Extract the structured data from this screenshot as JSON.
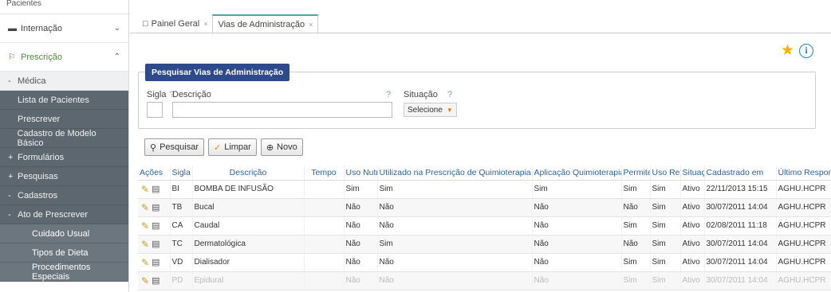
{
  "sidebar": {
    "top_label": "Pacientes",
    "items": [
      {
        "label": "Internação",
        "icon": "bed-icon",
        "chevron": "⌄"
      },
      {
        "label": "Prescrição",
        "icon": "pill-icon",
        "chevron": "⌃"
      }
    ],
    "medica": "Médica",
    "medica_prefix": "-",
    "sub": [
      {
        "prefix": "",
        "label": "Lista de Pacientes"
      },
      {
        "prefix": "",
        "label": "Prescrever"
      },
      {
        "prefix": "",
        "label": "Cadastro de Modelo Básico"
      },
      {
        "prefix": "+",
        "label": "Formulários"
      },
      {
        "prefix": "+",
        "label": "Pesquisas"
      },
      {
        "prefix": "-",
        "label": "Cadastros"
      },
      {
        "prefix": "-",
        "label": "Ato de Prescrever"
      }
    ],
    "sub2": [
      "Cuidado Usual",
      "Tipos de Dieta",
      "Procedimentos Especiais"
    ]
  },
  "tabs": [
    {
      "label": "Painel Geral",
      "close": "×"
    },
    {
      "label": "Vias de Administração",
      "close": "×"
    }
  ],
  "filter": {
    "legend": "Pesquisar Vias de Administração",
    "sigla_label": "Sigla",
    "descricao_label": "Descrição",
    "situacao_label": "Situação",
    "help": "?",
    "situacao_value": "Selecione"
  },
  "buttons": {
    "pesquisar": "Pesquisar",
    "limpar": "Limpar",
    "novo": "Novo"
  },
  "table": {
    "headers": [
      "Ações",
      "Sigla",
      "Descrição",
      "Tempo",
      "Uso Nutriç",
      "Utilizado na Prescrição de Quimioterapia",
      "Aplicação Quimioterapia CCA",
      "Permite E",
      "Uso Rece",
      "Situaçã",
      "Cadastrado em",
      "Último Responsável"
    ],
    "rows": [
      [
        "BI",
        "BOMBA DE INFUSÃO",
        "",
        "Sim",
        "Sim",
        "Sim",
        "Sim",
        "Sim",
        "Ativo",
        "22/11/2013 15:15",
        "AGHU.HCPR"
      ],
      [
        "TB",
        "Bucal",
        "",
        "Não",
        "Não",
        "Não",
        "Não",
        "Sim",
        "Ativo",
        "30/07/2011 14:04",
        "AGHU.HCPR"
      ],
      [
        "CA",
        "Caudal",
        "",
        "Não",
        "Não",
        "Não",
        "Sim",
        "Sim",
        "Ativo",
        "02/08/2011 11:18",
        "AGHU.HCPR"
      ],
      [
        "TC",
        "Dermatológica",
        "",
        "Não",
        "Sim",
        "Não",
        "Não",
        "Sim",
        "Ativo",
        "30/07/2011 14:04",
        "AGHU.HCPR"
      ],
      [
        "VD",
        "Dialisador",
        "",
        "Não",
        "Não",
        "Não",
        "Sim",
        "Sim",
        "Ativo",
        "30/07/2011 14:04",
        "AGHU.HCPR"
      ],
      [
        "PD",
        "Epidural",
        "",
        "Não",
        "Não",
        "Não",
        "Sim",
        "Sim",
        "Ativo",
        "30/07/2011 14:04",
        "AGHU.HCPR"
      ]
    ]
  },
  "colors": {
    "accent": "#2f4a8a",
    "sidebar_dark": "#5c6770",
    "star": "#f0b400",
    "info": "#2a7fc0"
  }
}
